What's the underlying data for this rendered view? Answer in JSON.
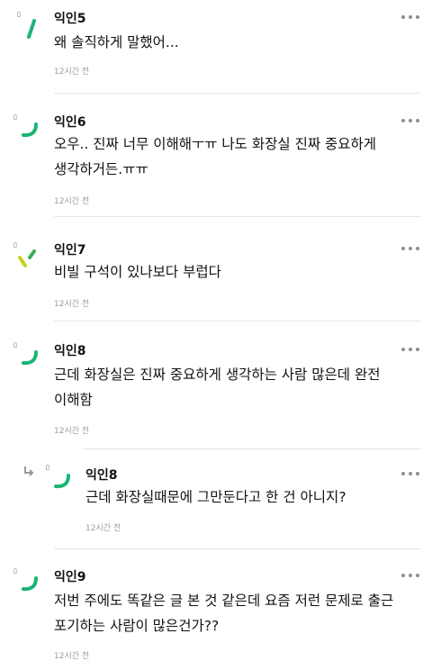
{
  "comments": [
    {
      "name": "익인5",
      "text": "왜 솔직하게 말했어...",
      "time": "12시간 전",
      "menu_icon": "more-horizontal-icon",
      "avatar_icon": "anonymous-avatar-icon",
      "avatar_colors": [
        "#1bb575",
        "#1bb575"
      ]
    },
    {
      "name": "익인6",
      "text": "오우.. 진짜 너무 이해해ㅜㅠ 나도 화장실 진짜 중요하게 생각하거든.ㅠㅠ",
      "time": "12시간 전",
      "menu_icon": "more-horizontal-icon",
      "avatar_icon": "anonymous-avatar-icon",
      "avatar_colors": [
        "#1bb575",
        "#1bb575"
      ]
    },
    {
      "name": "익인7",
      "text": "비빌 구석이 있나보다 부럽다",
      "time": "12시간 전",
      "menu_icon": "more-horizontal-icon",
      "avatar_icon": "anonymous-avatar-icon",
      "avatar_colors": [
        "#c2d41e",
        "#36b05a"
      ]
    },
    {
      "name": "익인8",
      "text": "근데 화장실은 진짜 중요하게 생각하는 사람 많은데 완전 이해함",
      "time": "12시간 전",
      "menu_icon": "more-horizontal-icon",
      "avatar_icon": "anonymous-avatar-icon",
      "avatar_colors": [
        "#1bb575",
        "#1bb575"
      ]
    },
    {
      "name": "익인8",
      "text": "근데 화장실때문에 그만둔다고 한 건 아니지?",
      "time": "12시간 전",
      "menu_icon": "more-horizontal-icon",
      "avatar_icon": "anonymous-avatar-icon",
      "avatar_colors": [
        "#1bb575",
        "#1bb575"
      ],
      "reply_icon": "reply-arrow-icon"
    },
    {
      "name": "익인9",
      "text": "저번 주에도 똑같은 글 본 것 같은데 요즘 저런 문제로 출근 포기하는 사람이 많은건가??",
      "time": "12시간 전",
      "menu_icon": "more-horizontal-icon",
      "avatar_icon": "anonymous-avatar-icon",
      "avatar_colors": [
        "#1bb575",
        "#1bb575"
      ]
    }
  ]
}
